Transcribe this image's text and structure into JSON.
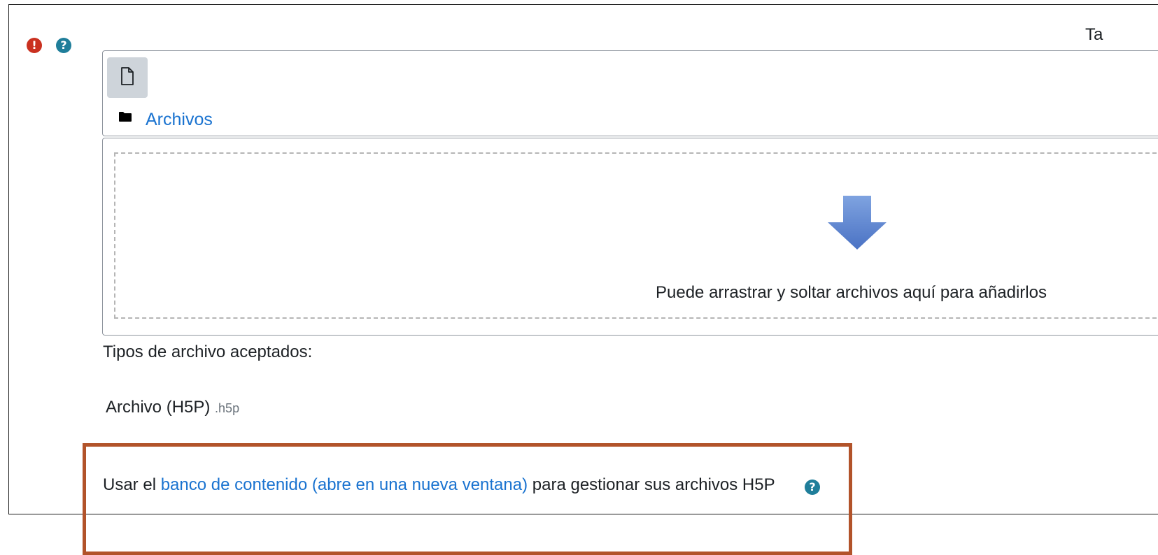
{
  "form": {
    "top_right_text": "Ta",
    "required_icon": "exclamation-circle-icon",
    "help_icon": "question-circle-icon"
  },
  "filemanager": {
    "add_file_icon": "file-icon",
    "folder_icon": "folder-icon",
    "path_link": "Archivos",
    "drop_arrow_icon": "down-arrow-icon",
    "drop_text": "Puede arrastrar y soltar archivos aquí para añadirlos"
  },
  "accepted": {
    "label": "Tipos de archivo aceptados:",
    "type_name": "Archivo (H5P)",
    "type_ext": ".h5p"
  },
  "content_bank": {
    "prefix": "Usar el ",
    "link_text": "banco de contenido (abre en una nueva ventana)",
    "suffix": " para gestionar sus archivos H5P",
    "help_icon": "question-circle-icon"
  },
  "colors": {
    "link": "#1a73d0",
    "required": "#ca3120",
    "help": "#1f7e9a",
    "highlight": "#b2532a"
  }
}
